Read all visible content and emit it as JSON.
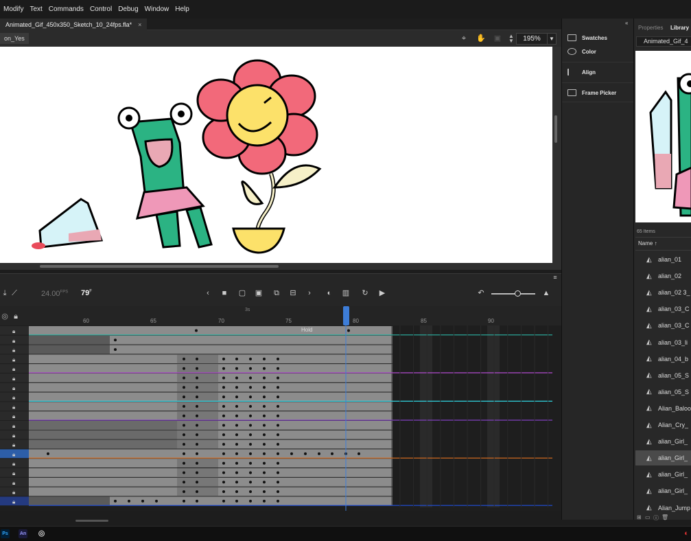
{
  "menu": [
    "Modify",
    "Text",
    "Commands",
    "Control",
    "Debug",
    "Window",
    "Help"
  ],
  "document_tab": {
    "title": "Animated_Gif_450x350_Sketch_10_24fps.fla*",
    "close": "×"
  },
  "stage_toolbar": {
    "scene": "on_Yes",
    "zoom": "195%"
  },
  "timeline": {
    "fps": "24.00",
    "fps_unit": "FPS",
    "current_frame": "79",
    "frame_unit": "F",
    "seconds_marker": "3s",
    "ruler_numbers": [
      "60",
      "65",
      "70",
      "75",
      "80",
      "85",
      "90"
    ],
    "hold_label": "Hold"
  },
  "dock_panels": [
    "Swatches",
    "Color",
    "Align",
    "Frame Picker"
  ],
  "library": {
    "tabs": [
      "Properties",
      "Library"
    ],
    "document": "Animated_Gif_4",
    "item_count": "65 Items",
    "name_header": "Name",
    "items": [
      "alian_01",
      "alian_02",
      "alian_02 3_",
      "alian_03_C",
      "alian_03_C",
      "alian_03_li",
      "alian_04_b",
      "alian_05_S",
      "alian_05_S",
      "Alian_Baloo",
      "Alian_Cry_",
      "alian_Girl_",
      "alian_Girl_",
      "alian_Girl_",
      "alian_Girl_",
      "Alian_Jump"
    ],
    "selected_index": 12
  },
  "taskbar": {
    "apps": [
      "Ps",
      "An"
    ]
  },
  "colors": {
    "accent_blue": "#3d7dd8",
    "playhead": "#3d7dd8",
    "frame_gray": "#8c8c8c"
  }
}
